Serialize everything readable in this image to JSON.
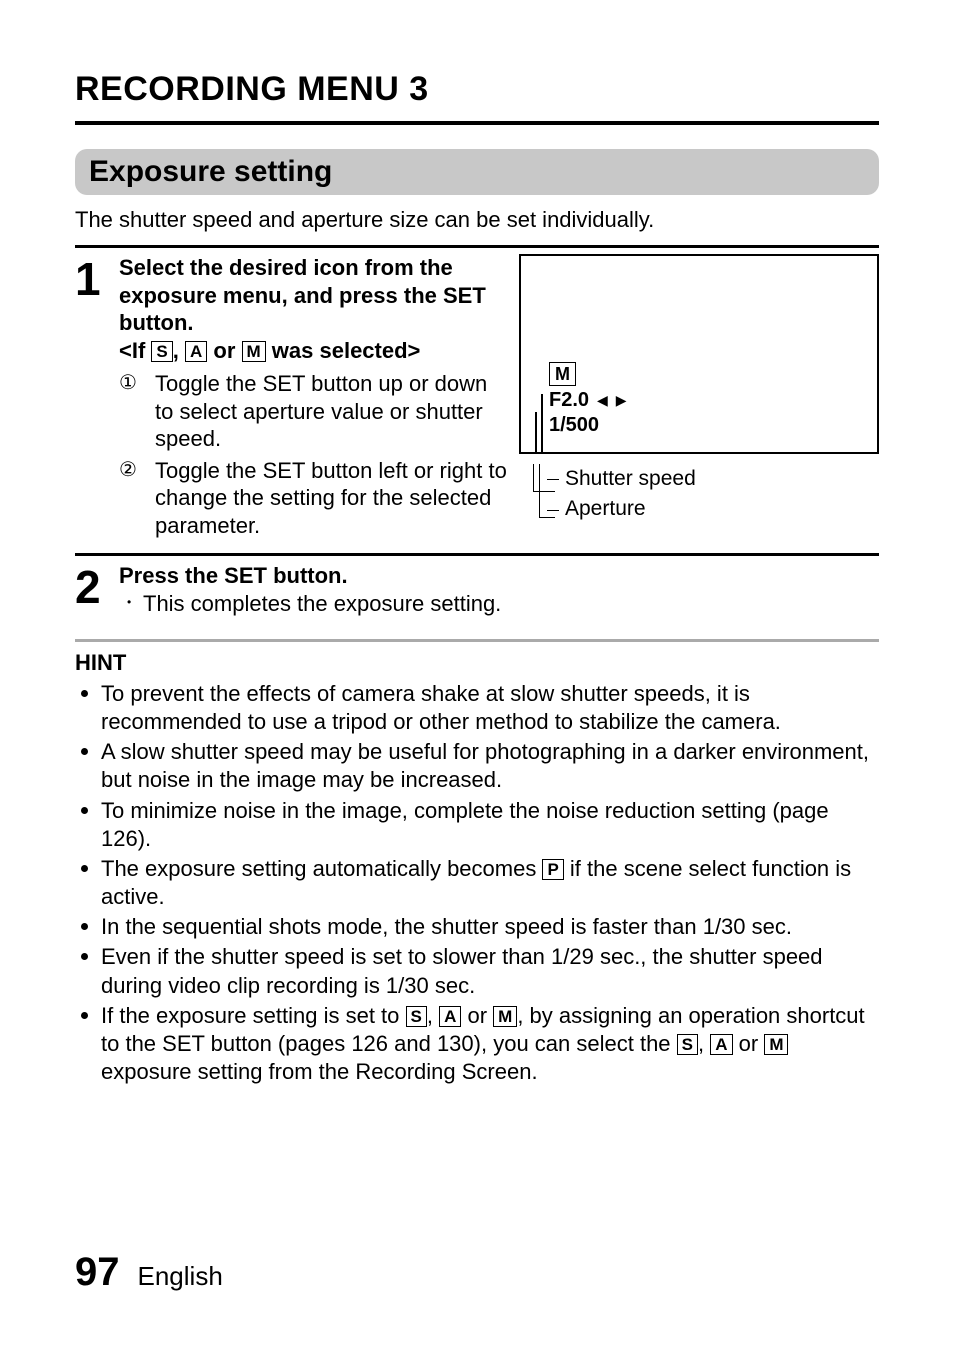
{
  "page": {
    "title": "RECORDING MENU 3",
    "section_title": "Exposure setting",
    "intro": "The shutter speed and aperture size can be set individually.",
    "number": "97",
    "language": "English"
  },
  "icons": {
    "S": "S",
    "A": "A",
    "M": "M",
    "P": "P"
  },
  "step1": {
    "number": "1",
    "heading": "Select the desired icon from the exposure menu, and press the SET button.",
    "condition_prefix": "<If ",
    "condition_mid1": ", ",
    "condition_mid2": " or ",
    "condition_suffix": " was selected>",
    "sub1_num": "①",
    "sub1": "Toggle the SET button up or down to select aperture value or shutter speed.",
    "sub2_num": "②",
    "sub2": "Toggle the SET button left or right to change the setting for the selected parameter."
  },
  "lcd": {
    "mode": "M",
    "aperture": "F2.0",
    "arrows": "◀ ▶",
    "shutter": "1/500",
    "label_shutter": "Shutter speed",
    "label_aperture": "Aperture"
  },
  "step2": {
    "number": "2",
    "heading": "Press the SET button.",
    "bullet": "This completes the exposure setting."
  },
  "hint": {
    "title": "HINT",
    "items": {
      "h1": "To prevent the effects of camera shake at slow shutter speeds, it is recommended to use a tripod or other method to stabilize the camera.",
      "h2": "A slow shutter speed may be useful for photographing in a darker environment, but noise in the image may be increased.",
      "h3": "To minimize noise in the image, complete the noise reduction setting (page 126).",
      "h4a": "The exposure setting automatically becomes ",
      "h4b": " if the scene select function is active.",
      "h5": "In the sequential shots mode, the shutter speed is faster than 1/30 sec.",
      "h6": "Even if the shutter speed is set to slower than 1/29 sec., the shutter speed during video clip recording is 1/30 sec.",
      "h7a": "If the exposure setting is set to ",
      "h7b": ", ",
      "h7c": " or ",
      "h7d": ", by assigning an operation shortcut to the SET button (pages 126 and 130), you can select the ",
      "h7e": ", ",
      "h7f": " or ",
      "h7g": " exposure setting from the Recording Screen."
    }
  }
}
